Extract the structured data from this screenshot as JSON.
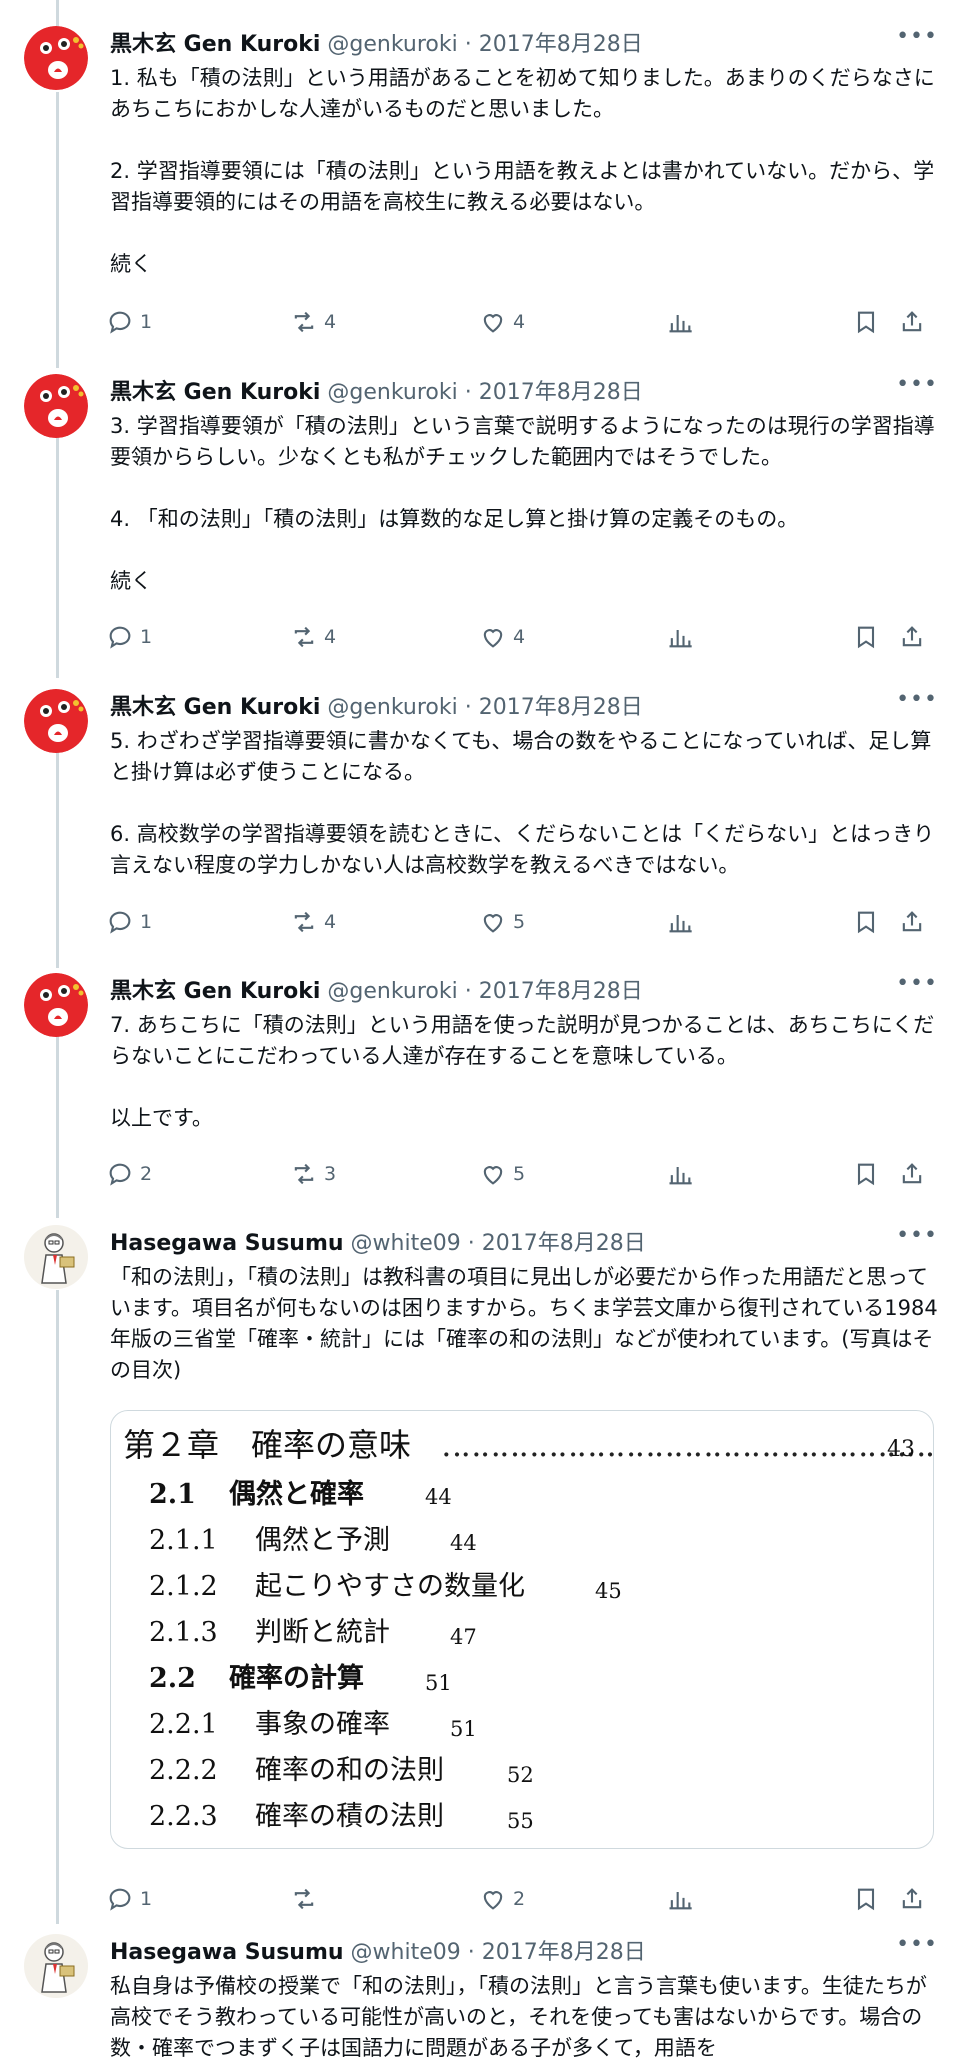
{
  "tweets": [
    {
      "name": "黒木玄 Gen Kuroki",
      "handle": "@genkuroki",
      "date": "2017年8月28日",
      "text": "1. 私も「積の法則」という用語があることを初めて知りました。あまりのくだらなさにあちこちにおかしな人達がいるものだと思いました。\n\n2. 学習指導要領には「積の法則」という用語を教えよとは書かれていない。だから、学習指導要領的にはその用語を高校生に教える必要はない。\n\n続く",
      "replies": "1",
      "retweets": "4",
      "likes": "4"
    },
    {
      "name": "黒木玄 Gen Kuroki",
      "handle": "@genkuroki",
      "date": "2017年8月28日",
      "text": "3. 学習指導要領が「積の法則」という言葉で説明するようになったのは現行の学習指導要領かららしい。少なくとも私がチェックした範囲内ではそうでした。\n\n4. 「和の法則」「積の法則」は算数的な足し算と掛け算の定義そのもの。\n\n続く",
      "replies": "1",
      "retweets": "4",
      "likes": "4"
    },
    {
      "name": "黒木玄 Gen Kuroki",
      "handle": "@genkuroki",
      "date": "2017年8月28日",
      "text": "5. わざわざ学習指導要領に書かなくても、場合の数をやることになっていれば、足し算と掛け算は必ず使うことになる。\n\n6. 高校数学の学習指導要領を読むときに、くだらないことは「くだらない」とはっきり言えない程度の学力しかない人は高校数学を教えるべきではない。",
      "replies": "1",
      "retweets": "4",
      "likes": "5"
    },
    {
      "name": "黒木玄 Gen Kuroki",
      "handle": "@genkuroki",
      "date": "2017年8月28日",
      "text": "7. あちこちに「積の法則」という用語を使った説明が見つかることは、あちこちにくだらないことにこだわっている人達が存在することを意味している。\n\n以上です。",
      "replies": "2",
      "retweets": "3",
      "likes": "5"
    },
    {
      "name": "Hasegawa Susumu",
      "handle": "@white09",
      "date": "2017年8月28日",
      "text": "「和の法則」，「積の法則」は教科書の項目に見出しが必要だから作った用語だと思っています。項目名が何もないのは困りますから。ちくま学芸文庫から復刊されている1984年版の三省堂「確率・統計」には「確率の和の法則」などが使われています。(写真はその目次)",
      "replies": "1",
      "retweets": "",
      "likes": "2"
    },
    {
      "name": "Hasegawa Susumu",
      "handle": "@white09",
      "date": "2017年8月28日",
      "text": "私自身は予備校の授業で「和の法則」，「積の法則」と言う言葉も使います。生徒たちが高校でそう教わっている可能性が高いのと，それを使っても害はないからです。場合の数・確率でつまずく子は国語力に問題がある子が多くて，用語を"
    }
  ],
  "toc": {
    "chapter": "第２章　確率の意味",
    "chapter_page": "43",
    "rows": [
      {
        "num": "2.1",
        "title": "偶然と確率",
        "page": "44",
        "bold": true
      },
      {
        "num": "2.1.1",
        "title": "偶然と予測",
        "page": "44",
        "bold": false
      },
      {
        "num": "2.1.2",
        "title": "起こりやすさの数量化",
        "page": "45",
        "bold": false
      },
      {
        "num": "2.1.3",
        "title": "判断と統計",
        "page": "47",
        "bold": false
      },
      {
        "num": "2.2",
        "title": "確率の計算",
        "page": "51",
        "bold": true
      },
      {
        "num": "2.2.1",
        "title": "事象の確率",
        "page": "51",
        "bold": false
      },
      {
        "num": "2.2.2",
        "title": "確率の和の法則",
        "page": "52",
        "bold": false
      },
      {
        "num": "2.2.3",
        "title": "確率の積の法則",
        "page": "55",
        "bold": false
      }
    ]
  },
  "colors": {
    "text": "#0f1419",
    "secondary": "#536471",
    "thread": "#cfd9de",
    "avatar_red": "#e5262a"
  },
  "icons": {
    "reply": "reply-icon",
    "retweet": "retweet-icon",
    "like": "like-icon",
    "views": "views-icon",
    "bookmark": "bookmark-icon",
    "share": "share-icon",
    "more": "more-icon"
  }
}
